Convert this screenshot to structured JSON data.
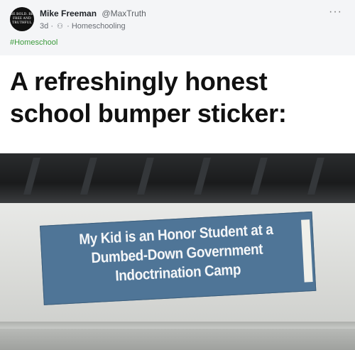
{
  "post": {
    "author_name": "Mike Freeman",
    "author_handle": "@MaxTruth",
    "age": "3d",
    "separator": "·",
    "group": "Homeschooling",
    "hashtag": "#Homeschool",
    "avatar_text": "BE BOLD. BE FREE AND TRUTHFUL",
    "more_label": "···"
  },
  "image": {
    "caption_line1": "A refreshingly honest",
    "caption_line2": "school bumper sticker:",
    "sticker_line1": "My Kid is an Honor Student at a",
    "sticker_line2": "Dumbed-Down Government",
    "sticker_line3": "Indoctrination Camp"
  }
}
